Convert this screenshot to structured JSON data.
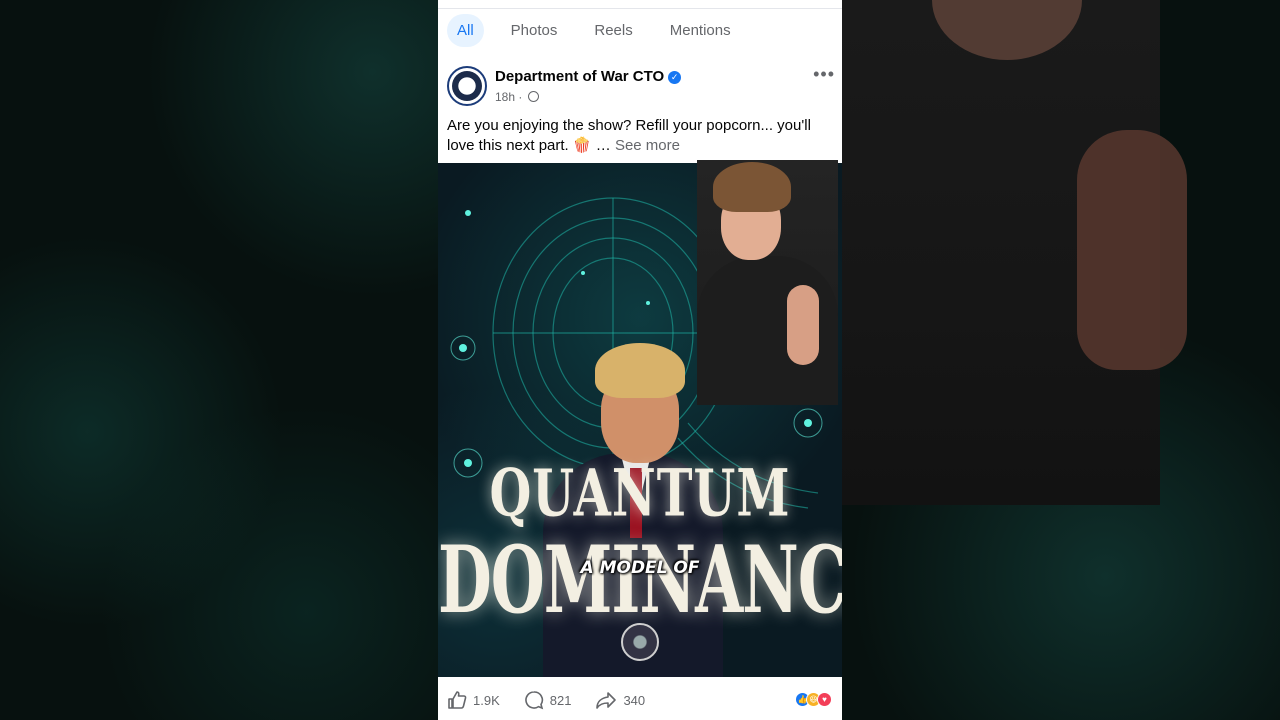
{
  "tabs": [
    {
      "label": "All"
    },
    {
      "label": "Photos"
    },
    {
      "label": "Reels"
    },
    {
      "label": "Mentions"
    }
  ],
  "post": {
    "author": "Department of War CTO",
    "time": "18h",
    "separator": "·",
    "caption_line": "Are you enjoying the show? Refill your popcorn... you'll love this next part.",
    "popcorn_emoji": "🍿",
    "ellipsis": " … ",
    "see_more": "See more"
  },
  "poster": {
    "title_top": "QUANTUM",
    "title_bottom": "DOMINANCE",
    "subtitle": "A MODEL OF"
  },
  "stats": {
    "likes": "1.9K",
    "comments": "821",
    "shares": "340"
  },
  "colors": {
    "accent": "#1877f2",
    "tab_active_bg": "#e7f3ff",
    "muted": "#65676b",
    "poster_glow": "#1fb7a8"
  },
  "icons": [
    "more-dots-icon",
    "verified-badge-icon",
    "globe-icon",
    "like-icon",
    "comment-icon",
    "share-icon",
    "reaction-like-icon",
    "reaction-haha-icon",
    "reaction-love-icon"
  ]
}
